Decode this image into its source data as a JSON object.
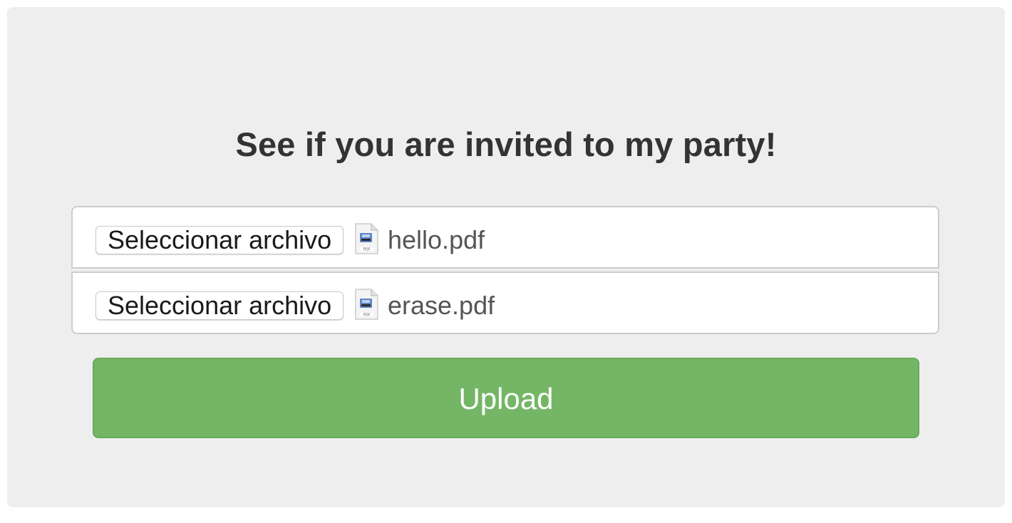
{
  "heading": "See if you are invited to my party!",
  "file_inputs": [
    {
      "button_label": "Seleccionar archivo",
      "file_name": "hello.pdf",
      "file_icon": "pdf-file-icon"
    },
    {
      "button_label": "Seleccionar archivo",
      "file_name": "erase.pdf",
      "file_icon": "pdf-file-icon"
    }
  ],
  "upload_button": {
    "label": "Upload"
  },
  "colors": {
    "panel_background": "#eeeeee",
    "upload_button": "#74b666",
    "heading_text": "#333333"
  }
}
